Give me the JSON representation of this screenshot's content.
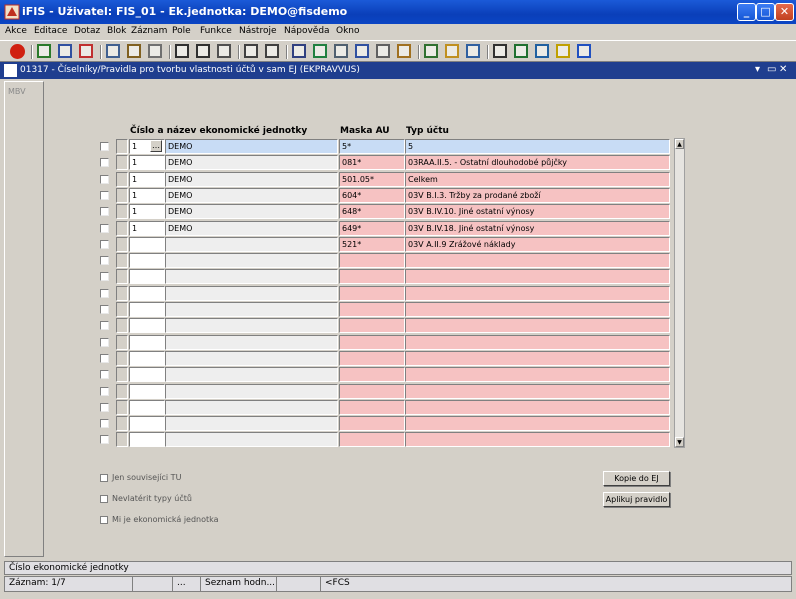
{
  "window": {
    "title": "iFIS - Uživatel: FIS_01 - Ek.jednotka: DEMO@fisdemo"
  },
  "menu": [
    "Akce",
    "Editace",
    "Dotaz",
    "Blok",
    "Záznam",
    "Pole",
    "Funkce",
    "Nástroje",
    "Nápověda",
    "Okno"
  ],
  "toolbar_icons": [
    "exit-icon",
    "save-icon",
    "query-icon",
    "clear-icon",
    "copy-icon",
    "paste-icon",
    "record-icon",
    "sort-asc-icon",
    "sort-desc-icon",
    "filter-icon",
    "print-icon",
    "print-preview-icon",
    "cut-icon",
    "link-icon",
    "calculator-icon",
    "columns-icon",
    "grid-icon",
    "report-icon",
    "hierarchy-icon",
    "chart-icon",
    "globe-icon",
    "sum-icon",
    "excel-icon",
    "web-icon",
    "key-icon",
    "help-icon"
  ],
  "form": {
    "title": "01317 - Číselníky/Pravidla pro tvorbu vlastnosti účtů v sam EJ (EKPRAVVUS)",
    "left_mark": "MBV"
  },
  "headers": {
    "ej": "Číslo a název ekonomické jednotky",
    "mask": "Maska AU",
    "type": "Typ účtu"
  },
  "rows": [
    {
      "num": "1",
      "name": "DEMO",
      "mask": "5*",
      "type": "5"
    },
    {
      "num": "1",
      "name": "DEMO",
      "mask": "081*",
      "type": "03RAA.II.5. - Ostatní dlouhodobé půjčky"
    },
    {
      "num": "1",
      "name": "DEMO",
      "mask": "501.05*",
      "type": "Celkem"
    },
    {
      "num": "1",
      "name": "DEMO",
      "mask": "604*",
      "type": "03V B.I.3. Tržby za prodané zboží"
    },
    {
      "num": "1",
      "name": "DEMO",
      "mask": "648*",
      "type": "03V B.IV.10. Jiné ostatní výnosy"
    },
    {
      "num": "1",
      "name": "DEMO",
      "mask": "649*",
      "type": "03V B.IV.18. Jiné ostatní výnosy"
    },
    {
      "num": "",
      "name": "",
      "mask": "521*",
      "type": "03V A.II.9 Zrážové náklady"
    },
    {
      "num": "",
      "name": "",
      "mask": "",
      "type": ""
    },
    {
      "num": "",
      "name": "",
      "mask": "",
      "type": ""
    },
    {
      "num": "",
      "name": "",
      "mask": "",
      "type": ""
    },
    {
      "num": "",
      "name": "",
      "mask": "",
      "type": ""
    },
    {
      "num": "",
      "name": "",
      "mask": "",
      "type": ""
    },
    {
      "num": "",
      "name": "",
      "mask": "",
      "type": ""
    },
    {
      "num": "",
      "name": "",
      "mask": "",
      "type": ""
    },
    {
      "num": "",
      "name": "",
      "mask": "",
      "type": ""
    },
    {
      "num": "",
      "name": "",
      "mask": "",
      "type": ""
    },
    {
      "num": "",
      "name": "",
      "mask": "",
      "type": ""
    },
    {
      "num": "",
      "name": "",
      "mask": "",
      "type": ""
    },
    {
      "num": "",
      "name": "",
      "mask": "",
      "type": ""
    }
  ],
  "options": [
    "Jen souvisejíci TU",
    "Nevlatérit typy účtů",
    "Mi je ekonomická jednotka"
  ],
  "buttons": {
    "copy": "Kopie do EJ",
    "apply": "Aplikuj pravidlo"
  },
  "hint": "Číslo ekonomické jednotky",
  "status": [
    "Záznam: 1/7",
    "",
    "...",
    "Seznam hodn...",
    "",
    "<FCS"
  ]
}
